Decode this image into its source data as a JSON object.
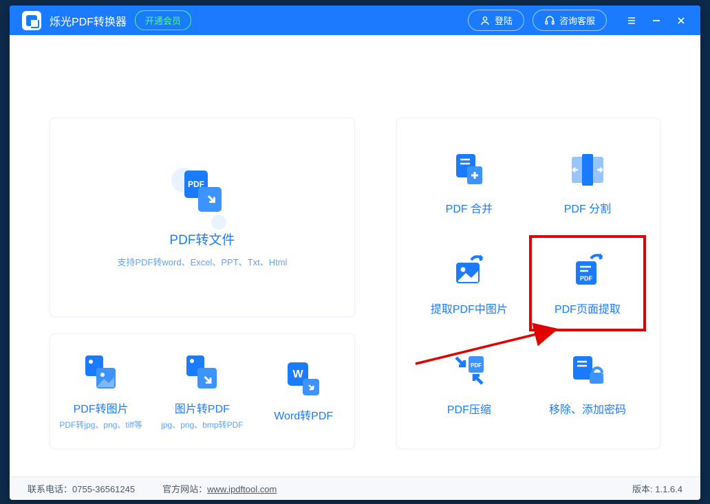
{
  "titlebar": {
    "app_title": "烁光PDF转换器",
    "vip": "开通会员",
    "login": "登陆",
    "support": "咨询客服"
  },
  "main": {
    "pdf_to_file": {
      "title": "PDF转文件",
      "sub": "支持PDF转word、Excel、PPT、Txt、Html"
    },
    "row": [
      {
        "title": "PDF转图片",
        "sub": "PDF转jpg、png、tiff等"
      },
      {
        "title": "图片转PDF",
        "sub": "jpg、png、bmp转PDF"
      },
      {
        "title": "Word转PDF",
        "sub": ""
      }
    ],
    "tools": [
      {
        "label": "PDF 合并",
        "icon": "pdf-merge-icon"
      },
      {
        "label": "PDF 分割",
        "icon": "pdf-split-icon"
      },
      {
        "label": "提取PDF中图片",
        "icon": "pdf-extract-image-icon"
      },
      {
        "label": "PDF页面提取",
        "icon": "pdf-extract-page-icon"
      },
      {
        "label": "PDF压缩",
        "icon": "pdf-compress-icon"
      },
      {
        "label": "移除、添加密码",
        "icon": "pdf-password-icon"
      }
    ]
  },
  "footer": {
    "phone_label": "联系电话：",
    "phone": "0755-36561245",
    "website_label": "官方网站：",
    "website": "www.ipdftool.com",
    "version_label": "版本: ",
    "version": "1.1.6.4"
  }
}
